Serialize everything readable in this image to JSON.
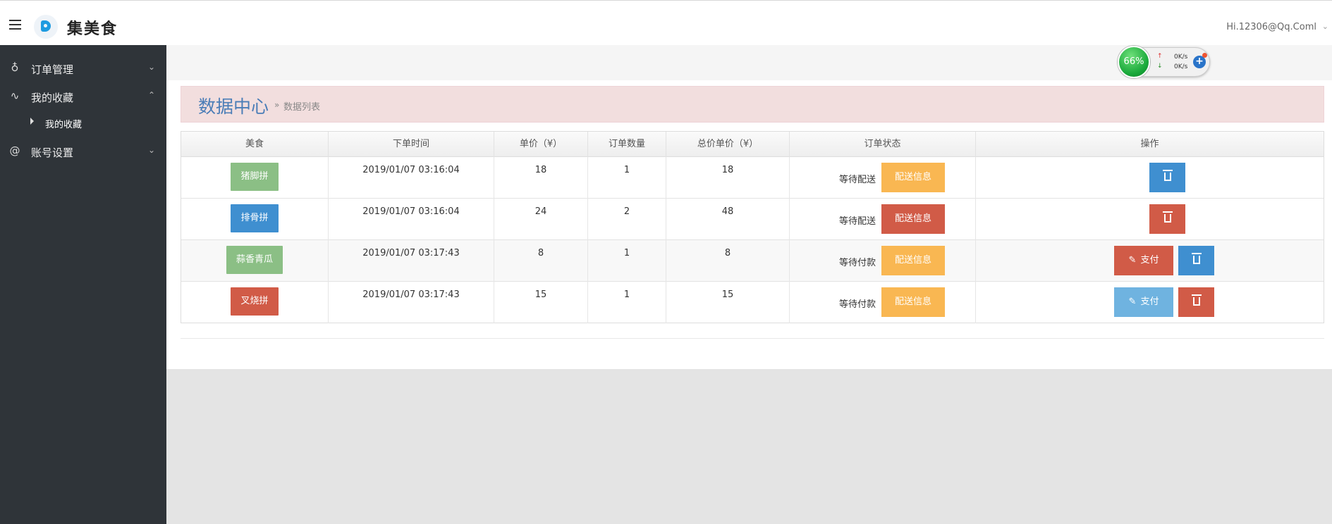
{
  "header": {
    "brand": "集美食",
    "user": "Hi.12306@Qq.Coml",
    "user_caret": "⌄"
  },
  "sidebar": {
    "items": [
      {
        "label": "订单管理",
        "icon": "ribbon-icon",
        "glyph": "♁",
        "chevron": "⌄"
      },
      {
        "label": "我的收藏",
        "icon": "activity-icon",
        "glyph": "∿",
        "chevron": "⌃"
      },
      {
        "label": "账号设置",
        "icon": "at-icon",
        "glyph": "@",
        "chevron": "⌄"
      }
    ],
    "sub_item": "我的收藏"
  },
  "net_widget": {
    "percent": "66%",
    "up_speed": "0K/s",
    "down_speed": "0K/s",
    "up_arrow": "↑",
    "down_arrow": "↓",
    "plus": "+"
  },
  "page": {
    "title": "数据中心",
    "crumb_sep": "»",
    "crumb": "数据列表"
  },
  "table": {
    "headers": [
      "美食",
      "下单时间",
      "单价（¥）",
      "订单数量",
      "总价单价（¥）",
      "订单状态",
      "操作"
    ],
    "ship_label": "配送信息",
    "pay_label": "支付",
    "rows": [
      {
        "food": "猪脚拼",
        "time": "2019/01/07 03:16:04",
        "price": "18",
        "qty": "1",
        "total": "18",
        "status": "等待配送"
      },
      {
        "food": "排骨拼",
        "time": "2019/01/07 03:16:04",
        "price": "24",
        "qty": "2",
        "total": "48",
        "status": "等待配送"
      },
      {
        "food": "蒜香青瓜",
        "time": "2019/01/07 03:17:43",
        "price": "8",
        "qty": "1",
        "total": "8",
        "status": "等待付款"
      },
      {
        "food": "叉烧拼",
        "time": "2019/01/07 03:17:43",
        "price": "15",
        "qty": "1",
        "total": "15",
        "status": "等待付款"
      }
    ]
  },
  "colors": {
    "green": "#8bbf85",
    "blue": "#3f8fd0",
    "red": "#d15b47",
    "orange": "#f9b752",
    "light_blue": "#6fb3e0",
    "sidebar": "#2f3439"
  }
}
